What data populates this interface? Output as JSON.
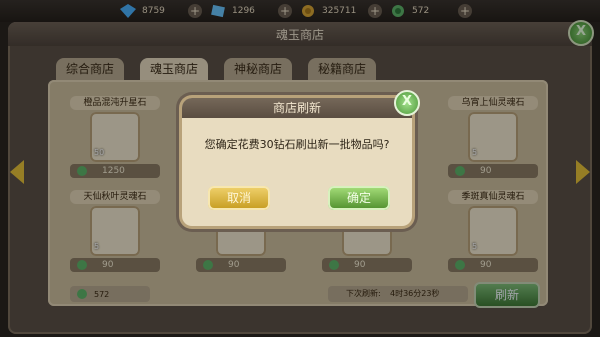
{
  "currencies": [
    {
      "icon": "blue-diamond-icon",
      "value": "8759"
    },
    {
      "icon": "blue-crystal-icon",
      "value": "1296"
    },
    {
      "icon": "gold-coin-icon",
      "value": "325711"
    },
    {
      "icon": "green-spiral-icon",
      "value": "572"
    }
  ],
  "header": {
    "title": "魂玉商店",
    "close": "X"
  },
  "tabs": [
    {
      "label": "综合商店",
      "active": false
    },
    {
      "label": "魂玉商店",
      "active": true
    },
    {
      "label": "神秘商店",
      "active": false
    },
    {
      "label": "秘籍商店",
      "active": false
    }
  ],
  "items": [
    {
      "name": "橙品混沌升星石",
      "level": "50",
      "price": "1250"
    },
    {
      "name": "乌宵上仙灵魂石",
      "level": "5",
      "price": "90"
    },
    {
      "name": "天仙秋叶灵魂石",
      "level": "5",
      "price": "90"
    },
    {
      "name": "",
      "level": "",
      "price": "90"
    },
    {
      "name": "",
      "level": "",
      "price": "90"
    },
    {
      "name": "季斑真仙灵魂石",
      "level": "5",
      "price": "90"
    }
  ],
  "footer": {
    "soul_jade": "572",
    "next_refresh_label": "下次刷新:",
    "next_refresh_time": "4时36分23秒",
    "refresh_button": "刷新"
  },
  "modal": {
    "title": "商店刷新",
    "close": "X",
    "message": "您确定花费30钻石刷出新一批物品吗?",
    "cancel": "取消",
    "confirm": "确定"
  }
}
